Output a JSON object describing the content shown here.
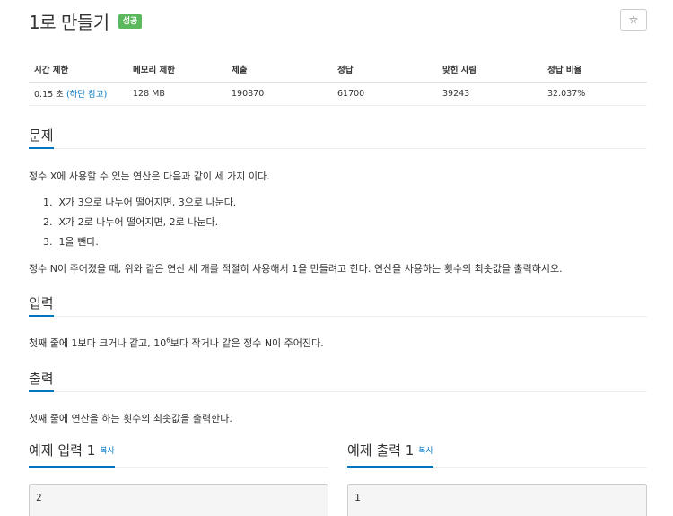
{
  "header": {
    "title": "1로 만들기",
    "badge": "성공",
    "star_icon": "☆"
  },
  "stats": {
    "headers": [
      "시간 제한",
      "메모리 제한",
      "제출",
      "정답",
      "맞힌 사람",
      "정답 비율"
    ],
    "time_value": "0.15 초 ",
    "time_link": "(하단 참고)",
    "memory": "128 MB",
    "submissions": "190870",
    "correct": "61700",
    "solvers": "39243",
    "ratio": "32.037%"
  },
  "problem": {
    "heading": "문제",
    "intro": "정수 X에 사용할 수 있는 연산은 다음과 같이 세 가지 이다.",
    "ops": [
      {
        "num": "1.",
        "text": "X가 3으로 나누어 떨어지면, 3으로 나눈다."
      },
      {
        "num": "2.",
        "text": "X가 2로 나누어 떨어지면, 2로 나눈다."
      },
      {
        "num": "3.",
        "text": "1을 뺀다."
      }
    ],
    "task": "정수 N이 주어졌을 때, 위와 같은 연산 세 개를 적절히 사용해서 1을 만들려고 한다. 연산을 사용하는 횟수의 최솟값을 출력하시오."
  },
  "input": {
    "heading": "입력",
    "text_pre": "첫째 줄에 1보다 크거나 같고, 10",
    "text_sup": "6",
    "text_post": "보다 작거나 같은 정수 N이 주어진다."
  },
  "output": {
    "heading": "출력",
    "text": "첫째 줄에 연산을 하는 횟수의 최솟값을 출력한다."
  },
  "samples": {
    "input_heading": "예제 입력 1",
    "output_heading": "예제 출력 1",
    "copy_label": "복사",
    "input_value": "2",
    "output_value": "1"
  },
  "colors": {
    "accent": "#0076c0",
    "success": "#5cb85c"
  }
}
